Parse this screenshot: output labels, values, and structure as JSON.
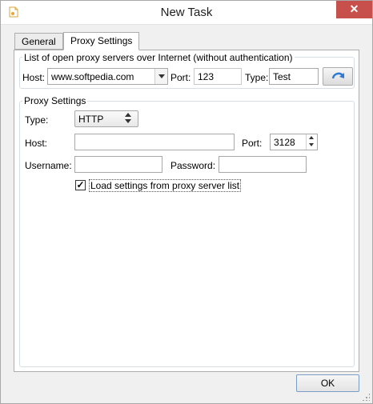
{
  "window": {
    "title": "New Task",
    "close_glyph": "✕",
    "app_icon": "document-icon"
  },
  "tabs": [
    {
      "label": "General",
      "active": false
    },
    {
      "label": "Proxy Settings",
      "active": true
    }
  ],
  "proxy_list": {
    "legend": "List of open proxy servers over Internet (without authentication)",
    "host_label": "Host:",
    "host_value": "www.softpedia.com",
    "port_label": "Port:",
    "port_value": "123",
    "type_label": "Type:",
    "type_value": "Test",
    "refresh_icon": "refresh-arrow-icon"
  },
  "proxy_settings": {
    "legend": "Proxy Settings",
    "type_label": "Type:",
    "type_value": "HTTP",
    "host_label": "Host:",
    "host_value": "",
    "port_label": "Port:",
    "port_value": "3128",
    "username_label": "Username:",
    "username_value": "",
    "password_label": "Password:",
    "password_value": "",
    "load_checkbox_label": "Load settings from proxy server list",
    "load_checkbox_checked": true,
    "check_glyph": "✓"
  },
  "footer": {
    "ok_label": "OK"
  },
  "colors": {
    "close_button": "#c7504c",
    "refresh_arrow": "#2b79d6",
    "ok_border": "#7a9ec8"
  }
}
